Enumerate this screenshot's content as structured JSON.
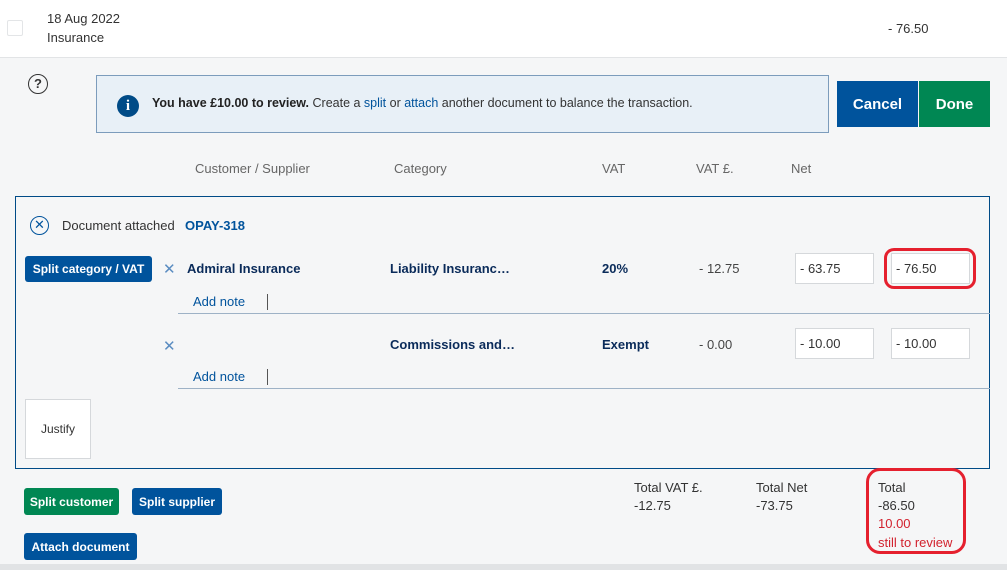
{
  "transaction": {
    "date": "18 Aug 2022",
    "description": "Insurance",
    "amount": "- 76.50"
  },
  "banner": {
    "bold": "You have £10.00 to review.",
    "text_before": " Create a ",
    "split_link": "split",
    "text_or": " or ",
    "attach_link": "attach",
    "text_after": " another document to balance the transaction."
  },
  "buttons": {
    "cancel": "Cancel",
    "done": "Done",
    "split_category_vat": "Split category / VAT",
    "justify": "Justify",
    "split_customer": "Split customer",
    "split_supplier": "Split supplier",
    "attach_document": "Attach document"
  },
  "columns": {
    "customer_supplier": "Customer / Supplier",
    "category": "Category",
    "vat": "VAT",
    "vat_amount": "VAT £.",
    "net": "Net"
  },
  "document": {
    "label": "Document attached",
    "ref": "OPAY-318"
  },
  "lines": [
    {
      "customer": "Admiral Insurance",
      "category": "Liability Insuranc…",
      "vat": "20%",
      "vat_amount": "- 12.75",
      "net": "- 63.75",
      "total": "- 76.50",
      "add_note": "Add note"
    },
    {
      "customer": "",
      "category": "Commissions and…",
      "vat": "Exempt",
      "vat_amount": "- 0.00",
      "net": "- 10.00",
      "total": "- 10.00",
      "add_note": "Add note"
    }
  ],
  "totals": {
    "vat_label": "Total VAT £.",
    "vat_value": "-12.75",
    "net_label": "Total Net",
    "net_value": "-73.75",
    "total_label": "Total",
    "total_value": "-86.50",
    "review_value": "10.00",
    "review_label": "still to review"
  },
  "icons": {
    "help": "question-circle-icon",
    "info": "info-icon",
    "remove_document": "close-circle-icon",
    "remove_line": "close-icon"
  },
  "colors": {
    "primary_blue": "#00539c",
    "success_green": "#008753",
    "alert_red": "#e5202e"
  }
}
